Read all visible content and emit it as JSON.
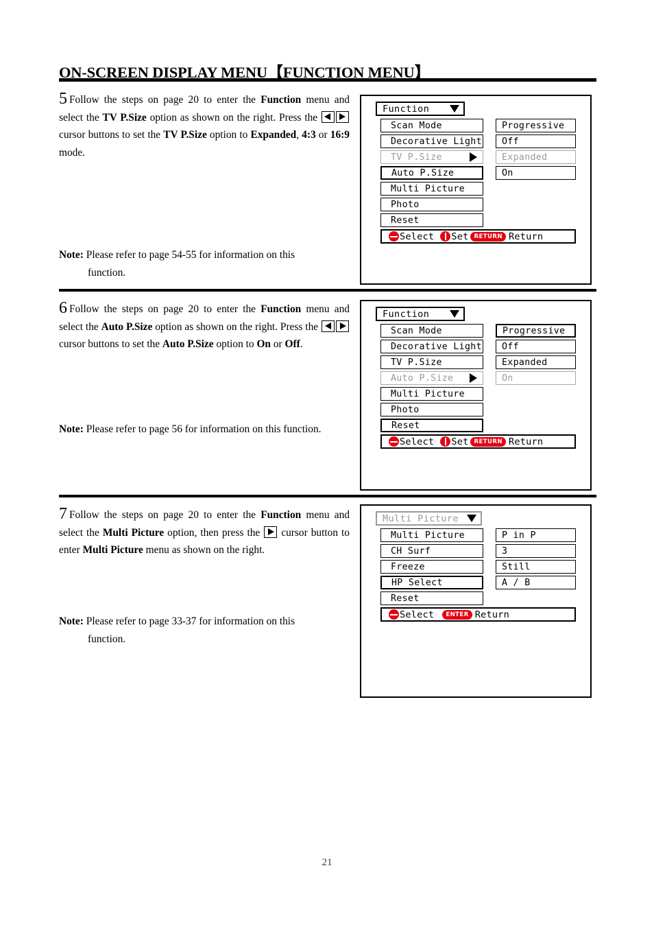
{
  "document": {
    "title_main": "ON-SCREEN DISPLAY MENU",
    "title_bracket_open": "【",
    "title_bracket_text": "FUNCTION MENU",
    "title_bracket_close": "】",
    "page_number": "21",
    "accent_color": "#e60012",
    "dim_color": "#9a9a9a"
  },
  "sections": [
    {
      "number": "5",
      "body_1": "Follow the steps on page 20 to enter the ",
      "body_bold_1": "Function",
      "body_2": " menu and select the ",
      "body_bold_2": "TV P.Size",
      "body_3": " option as shown on the right. Press the ",
      "body_4": " cursor buttons to set the ",
      "body_bold_3": "TV P.Size",
      "body_5": " option to ",
      "body_bold_4": "Expanded",
      "body_6": ", ",
      "body_bold_5": "4:3",
      "body_7": " or ",
      "body_bold_6": "16:9",
      "body_8": " mode.",
      "note_label": "Note:",
      "note_line_1": " Please refer to page 54-55 for information on this",
      "note_line_2": "function."
    },
    {
      "number": "6",
      "body_1": "Follow the steps on page 20 to enter the ",
      "body_bold_1": "Function",
      "body_2": " menu and select the ",
      "body_bold_2": "Auto P.Size",
      "body_3": " option as shown on the right. Press the ",
      "body_4": " cursor buttons to set the ",
      "body_bold_3": "Auto P.Size",
      "body_5": " option to ",
      "body_bold_4": "On",
      "body_6": " or ",
      "body_bold_5": "Off",
      "body_7": ".",
      "note_label": "Note:",
      "note_line_1": " Please refer to page 56 for information on this function."
    },
    {
      "number": "7",
      "body_1": "Follow the steps on page 20 to enter the ",
      "body_bold_1": "Function",
      "body_2": " menu and select the ",
      "body_bold_2": "Multi Picture",
      "body_3": " option, then press the ",
      "body_4": " cursor button to enter ",
      "body_bold_3": "Multi Picture",
      "body_5": " menu as shown on the right.",
      "note_label": "Note:",
      "note_line_1": " Please refer to page 33-37 for information on this",
      "note_line_2": "function."
    }
  ],
  "osd_panels": [
    {
      "title": "Function",
      "title_dim": false,
      "rows": [
        {
          "label": "Scan Mode",
          "value": "Progressive",
          "state": "normal",
          "arrow": false
        },
        {
          "label": "Decorative Light",
          "value": "Off",
          "state": "normal",
          "arrow": false
        },
        {
          "label": "TV P.Size",
          "value": "Expanded",
          "state": "dim",
          "arrow": true
        },
        {
          "label": "Auto P.Size",
          "value": "On",
          "state": "highlight",
          "arrow": false
        },
        {
          "label": "Multi Picture",
          "value": "",
          "state": "normal",
          "arrow": false
        },
        {
          "label": "Photo",
          "value": "",
          "state": "normal",
          "arrow": false
        },
        {
          "label": "Reset",
          "value": "",
          "state": "normal",
          "arrow": false
        }
      ],
      "footer": {
        "select_icon": "up-down-pad-icon",
        "select_label": "Select",
        "set_icon": "left-right-pad-icon",
        "set_label": "Set",
        "return_badge": "RETURN",
        "return_label": "Return"
      }
    },
    {
      "title": "Function",
      "title_dim": false,
      "rows": [
        {
          "label": "Scan Mode",
          "value": "Progressive",
          "state": "highlight",
          "arrow": false
        },
        {
          "label": "Decorative Light",
          "value": "Off",
          "state": "normal",
          "arrow": false
        },
        {
          "label": "TV P.Size",
          "value": "Expanded",
          "state": "normal",
          "arrow": false
        },
        {
          "label": "Auto P.Size",
          "value": "On",
          "state": "dim",
          "arrow": true
        },
        {
          "label": "Multi Picture",
          "value": "",
          "state": "normal",
          "arrow": false
        },
        {
          "label": "Photo",
          "value": "",
          "state": "normal",
          "arrow": false
        },
        {
          "label": "Reset",
          "value": "",
          "state": "highlight",
          "arrow": false
        }
      ],
      "footer": {
        "select_icon": "up-down-pad-icon",
        "select_label": "Select",
        "set_icon": "left-right-pad-icon",
        "set_label": "Set",
        "return_badge": "RETURN",
        "return_label": "Return"
      }
    },
    {
      "title": "Multi Picture",
      "title_dim": true,
      "rows": [
        {
          "label": "Multi Picture",
          "value": "P in P",
          "state": "normal",
          "arrow": false
        },
        {
          "label": "CH Surf",
          "value": "3",
          "state": "normal",
          "arrow": false
        },
        {
          "label": "Freeze",
          "value": "Still",
          "state": "normal",
          "arrow": false
        },
        {
          "label": "HP Select",
          "value": "A / B",
          "state": "highlight",
          "arrow": false
        },
        {
          "label": "Reset",
          "value": "",
          "state": "normal",
          "arrow": false
        }
      ],
      "footer": {
        "select_icon": "up-down-pad-icon",
        "select_label": "Select",
        "set_icon": "",
        "set_label": "",
        "return_badge": "ENTER",
        "return_label": "Return"
      }
    }
  ]
}
